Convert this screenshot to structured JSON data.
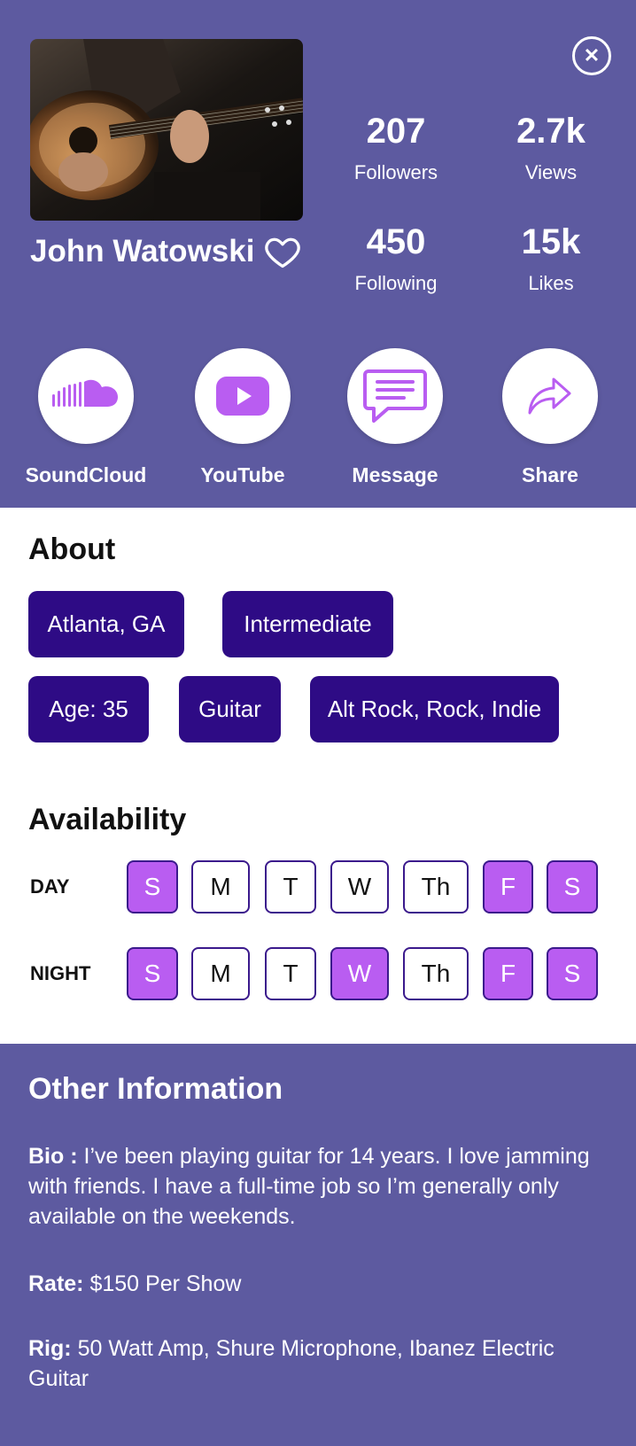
{
  "profile": {
    "name": "John Watowski",
    "stats": {
      "followers": {
        "value": "207",
        "label": "Followers"
      },
      "views": {
        "value": "2.7k",
        "label": "Views"
      },
      "following": {
        "value": "450",
        "label": "Following"
      },
      "likes": {
        "value": "15k",
        "label": "Likes"
      }
    }
  },
  "actions": [
    {
      "label": "SoundCloud",
      "icon": "soundcloud-icon"
    },
    {
      "label": "YouTube",
      "icon": "youtube-icon"
    },
    {
      "label": "Message",
      "icon": "message-icon"
    },
    {
      "label": "Share",
      "icon": "share-icon"
    }
  ],
  "about": {
    "title": "About",
    "tags": [
      "Atlanta, GA",
      "Intermediate",
      "Age: 35",
      "Guitar",
      "Alt Rock, Rock, Indie"
    ]
  },
  "availability": {
    "title": "Availability",
    "day_label": "DAY",
    "night_label": "NIGHT",
    "days": [
      "S",
      "M",
      "T",
      "W",
      "Th",
      "F",
      "S"
    ],
    "day_selected": [
      true,
      false,
      false,
      false,
      false,
      true,
      true
    ],
    "night_selected": [
      true,
      false,
      false,
      true,
      false,
      true,
      true
    ]
  },
  "other": {
    "title": "Other Information",
    "bio_label": "Bio :",
    "bio": "I’ve been playing guitar for 14 years. I love jamming with friends. I have a full-time job so I’m generally only available on the weekends.",
    "rate_label": "Rate:",
    "rate": "$150 Per Show",
    "rig_label": "Rig:",
    "rig": "50 Watt Amp, Shure Microphone, Ibanez Electric Guitar"
  },
  "colors": {
    "header_bg": "#5d5aa0",
    "tag_bg": "#2e0b85",
    "accent": "#b95df1"
  }
}
